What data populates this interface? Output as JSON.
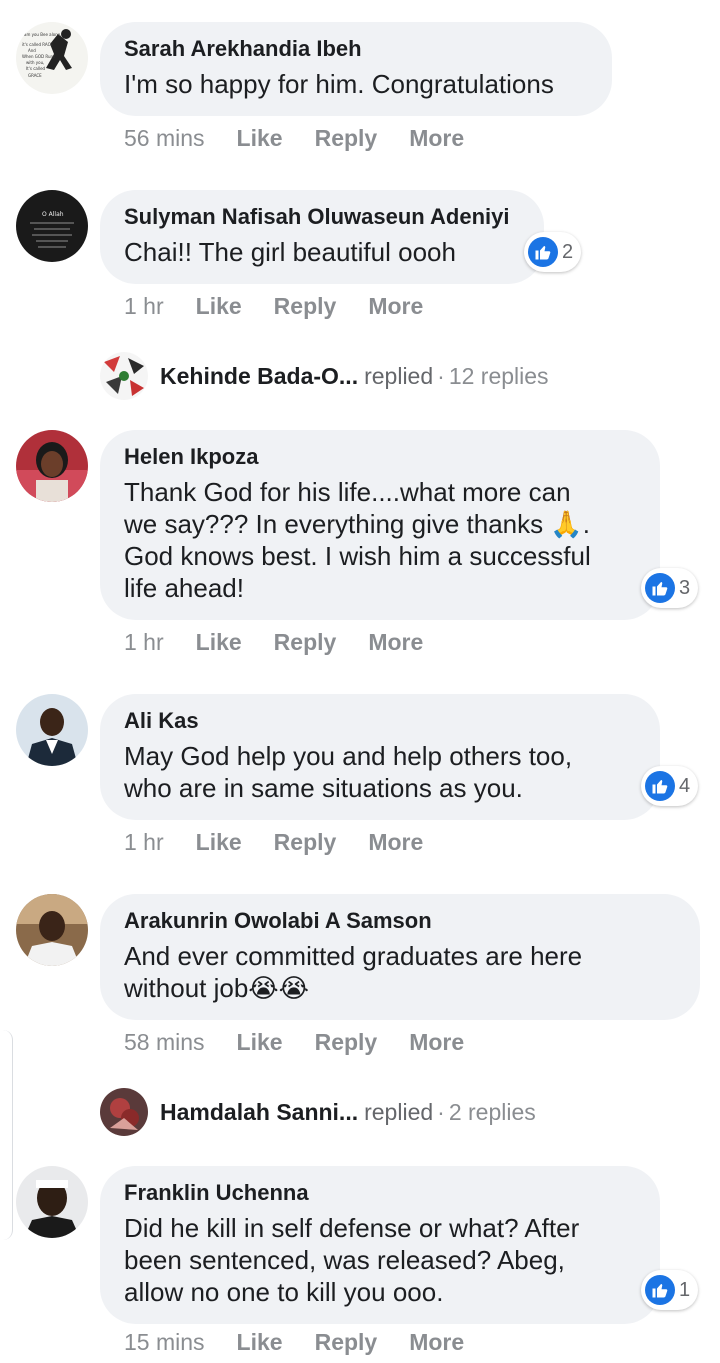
{
  "comments": [
    {
      "name": "Sarah Arekhandia Ibeh",
      "lines": [
        "I'm so happy for him. Congratulations"
      ],
      "time": "56 mins",
      "avatar_text": [
        "am you Bee alone,",
        "it's called RACE",
        "And",
        "When GOD Runs",
        "with you,",
        "It's called",
        "GRACE"
      ]
    },
    {
      "name": "Sulyman Nafisah Oluwaseun Adeniyi",
      "lines": [
        "Chai!! The girl beautiful oooh"
      ],
      "time": "1 hr",
      "reactions": "2",
      "avatar_text": [
        "O Allah"
      ]
    },
    {
      "name": "Helen Ikpoza",
      "lines": [
        "Thank God for his life....what more can",
        "we say??? In everything give thanks 🙏.",
        "God knows best. I wish him a successful",
        "life ahead!"
      ],
      "time": "1 hr",
      "reactions": "3"
    },
    {
      "name": "Ali Kas",
      "lines": [
        "May God help you and help others too,",
        "who are in same situations as you."
      ],
      "time": "1 hr",
      "reactions": "4"
    },
    {
      "name": "Arakunrin Owolabi A Samson",
      "lines": [
        "And ever committed graduates are here",
        "without job😭😭"
      ],
      "time": "58 mins"
    },
    {
      "name": "Franklin Uchenna",
      "lines": [
        "Did he kill in self defense or what? After",
        "been sentenced, was released? Abeg,",
        "allow no one to kill you ooo."
      ],
      "time": "15 mins",
      "reactions": "1"
    }
  ],
  "replies": [
    {
      "name": "Kehinde Bada-O...",
      "action": "replied",
      "separator": "·",
      "count": "12 replies"
    },
    {
      "name": "Hamdalah Sanni...",
      "action": "replied",
      "separator": "·",
      "count": "2 replies"
    }
  ],
  "actions": {
    "like": "Like",
    "reply": "Reply",
    "more": "More"
  },
  "colors": {
    "bubble": "#f0f2f5",
    "like_blue": "#1b74e4",
    "meta_gray": "#8a8d91"
  }
}
